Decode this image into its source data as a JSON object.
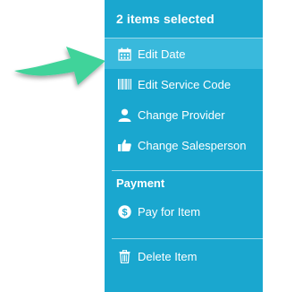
{
  "colors": {
    "panel_bg": "#1aa7cf",
    "active_bg": "#39b9dc",
    "arrow": "#3fd39a",
    "text": "#ffffff"
  },
  "panel": {
    "header": "2 items selected",
    "items": [
      {
        "label": "Edit Date",
        "icon": "calendar-icon",
        "active": true
      },
      {
        "label": "Edit Service Code",
        "icon": "barcode-icon"
      },
      {
        "label": "Change Provider",
        "icon": "user-icon"
      },
      {
        "label": "Change Salesperson",
        "icon": "thumbs-up-icon"
      }
    ],
    "payment": {
      "title": "Payment",
      "items": [
        {
          "label": "Pay for Item",
          "icon": "dollar-coin-icon"
        }
      ]
    },
    "delete": {
      "label": "Delete Item",
      "icon": "trash-icon"
    }
  }
}
